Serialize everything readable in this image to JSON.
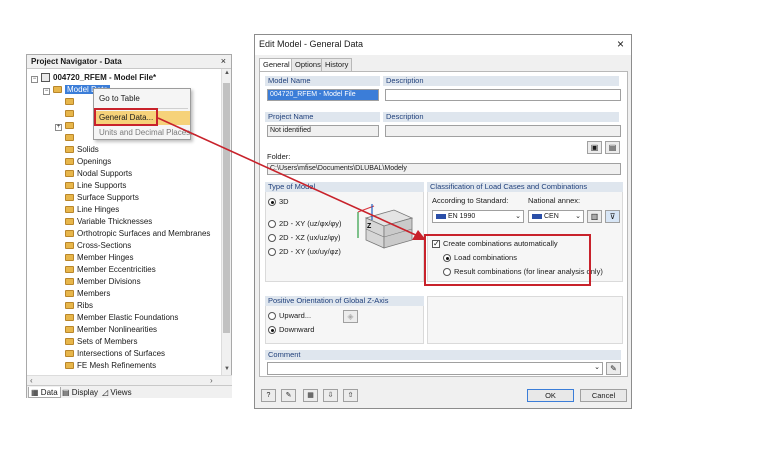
{
  "navigator": {
    "title": "Project Navigator - Data",
    "close_glyph": "×",
    "root_label": "004720_RFEM - Model File*",
    "model_data_label": "Model Data",
    "tree_items": [
      "Solids",
      "Openings",
      "Nodal Supports",
      "Line Supports",
      "Surface Supports",
      "Line Hinges",
      "Variable Thicknesses",
      "Orthotropic Surfaces and Membranes",
      "Cross-Sections",
      "Member Hinges",
      "Member Eccentricities",
      "Member Divisions",
      "Members",
      "Ribs",
      "Member Elastic Foundations",
      "Member Nonlinearities",
      "Sets of Members",
      "Intersections of Surfaces",
      "FE Mesh Refinements"
    ],
    "tabs": [
      "Data",
      "Display",
      "Views"
    ]
  },
  "context_menu": {
    "items": [
      "Go to Table",
      "General Data...",
      "Units and Decimal Places..."
    ]
  },
  "dialog": {
    "title": "Edit Model - General Data",
    "tabs": [
      "General",
      "Options",
      "History"
    ],
    "model_name_label": "Model Name",
    "model_name_value": "004720_RFEM - Model File",
    "description_label": "Description",
    "project_name_label": "Project Name",
    "project_name_value": "Not identified",
    "project_description_label": "Description",
    "folder_label": "Folder:",
    "folder_value": "C:\\Users\\mfise\\Documents\\DLUBAL\\Modely",
    "type_of_model_header": "Type of Model",
    "type_options": [
      "3D",
      "2D - XY (uz/φx/φy)",
      "2D - XZ (ux/uz/φy)",
      "2D - XY (ux/uy/φz)"
    ],
    "classification_header": "Classification of Load Cases and Combinations",
    "standard_label": "According to Standard:",
    "standard_value": "EN 1990",
    "annex_label": "National annex:",
    "annex_value": "CEN",
    "create_combinations_label": "Create combinations automatically",
    "combo_options": [
      "Load combinations",
      "Result combinations (for linear analysis only)"
    ],
    "z_axis_header": "Positive Orientation of Global Z-Axis",
    "z_options": [
      "Upward...",
      "Downward"
    ],
    "comment_header": "Comment",
    "ok_label": "OK",
    "cancel_label": "Cancel",
    "help_glyph": "?"
  },
  "colors": {
    "highlight": "#c8222b",
    "selection": "#3b7dd8",
    "menu_hover": "#f6d27a",
    "header_bg": "#dfe6ee"
  }
}
